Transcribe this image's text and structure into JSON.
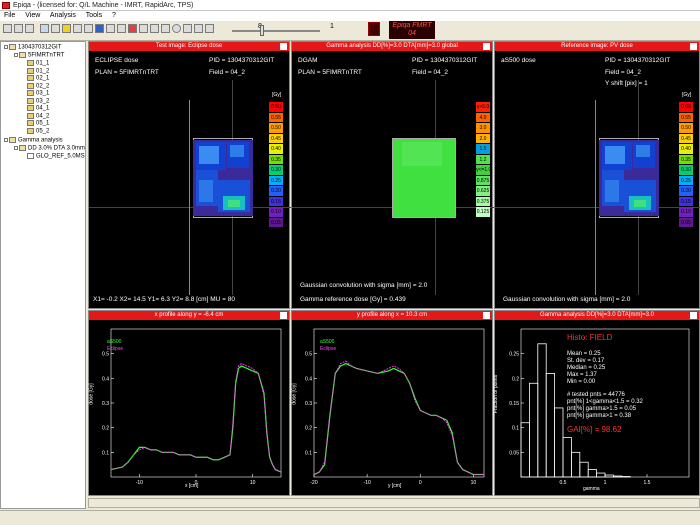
{
  "window": {
    "title": "Epiqa - (licensed for: Q/L Machine - IMRT, RapidArc, TPS)"
  },
  "menu": [
    "File",
    "View",
    "Analysis",
    "Tools",
    "?"
  ],
  "toolbar": {
    "slider_value": "8",
    "slider_right": "1",
    "logo_text": "Epiqa FMRT 04"
  },
  "tree": {
    "root": "1304370312GIT",
    "plan": "5FIMRTnTRT",
    "fields": [
      "01_1",
      "01_2",
      "02_1",
      "02_2",
      "03_1",
      "03_2",
      "04_1",
      "04_2",
      "05_1",
      "05_2"
    ],
    "gamma_group": "Gamma analysis",
    "gamma_item": "DD 3.0% DTA 3.0mm",
    "gamma_sub": "GLO_REF_5.0MS"
  },
  "panels": {
    "p1": {
      "title": "Test image: Eclipse dose",
      "name": "ECLIPSE dose",
      "pid_label": "PID = 1304370312GIT",
      "plan_label": "PLAN = 5FIMRTnTRT",
      "field_label": "Field = 04_2",
      "footer": "X1= -0.2  X2= 14.5  Y1= 6.3  Y2= 8.8  [cm]    MU = 80",
      "unit": "[Gy]",
      "scale": [
        "0.60",
        "0.55",
        "0.50",
        "0.45",
        "0.40",
        "0.35",
        "0.30",
        "0.25",
        "0.20",
        "0.15",
        "0.10",
        "0.05"
      ]
    },
    "p2": {
      "title": "Gamma analysis DD[%]=3.0 DTA[mm]=3.0  global",
      "name": "DGAM",
      "pid_label": "PID = 1304370312GIT",
      "plan_label": "PLAN = 5FIMRTnTRT",
      "field_label": "Field = 04_2",
      "footer1": "Gaussian convolution with sigma [mm] = 2.0",
      "footer2": "Gamma reference dose [Gy] =      0.439",
      "scale": [
        "γ>5.0",
        "4.0",
        "3.0",
        "2.0",
        "1.5",
        "1.2",
        "γ<=1.0",
        "0.875",
        "0.625",
        "0.375",
        "0.125"
      ]
    },
    "p3": {
      "title": "Reference image: PV dose",
      "name": "aS500 dose",
      "pid_label": "PID = 1304370312GIT",
      "field_label": "Field = 04_2",
      "shift_label": "Y shift [pix] =    1",
      "footer": "Gaussian convolution with sigma [mm] = 2.0",
      "unit": "[Gy]",
      "scale": [
        "0.60",
        "0.55",
        "0.50",
        "0.45",
        "0.40",
        "0.35",
        "0.30",
        "0.25",
        "0.20",
        "0.15",
        "0.10",
        "0.05"
      ]
    },
    "p4": {
      "title": "x profile along y =  -6.4 cm",
      "legend1": "aS500",
      "legend2": "Eclipse",
      "xlabel": "x [cm]",
      "ylabel": "dose [Gy]"
    },
    "p5": {
      "title": "y profile along x =  10.3 cm",
      "legend1": "aS500",
      "legend2": "Eclipse",
      "xlabel": "y [cm]",
      "ylabel": "dose [Gy]"
    },
    "p6": {
      "title": "Gamma analysis DD[%]=3.0 DTA[mm]=3.0",
      "histo_title": "Histo: FIELD",
      "stats": [
        "Mean   =  0.25",
        "St. dev  =  0.17",
        "Median  =  0.25",
        "Max      =  1.37",
        "Min      =  0.00"
      ],
      "tested": "# tested pnts  =  44776",
      "pnt1": "pnt[%]  1<gamma<1.5  =  0.32",
      "pnt2": "pnt[%]  gamma>1.5  =  0.05",
      "pnt3": "pnt[%]  gamma>1  =  0.38",
      "gai": "GAI[%]  =   98.62",
      "xlabel": "gamma",
      "ylabel": "Fraction of points"
    }
  },
  "chart_data": [
    {
      "type": "line",
      "title": "x profile along y = -6.4 cm",
      "xlabel": "x [cm]",
      "ylabel": "dose [Gy]",
      "xlim": [
        -15,
        15
      ],
      "ylim": [
        0,
        0.6
      ],
      "xticks": [
        "-10",
        "0",
        "10"
      ],
      "yticks": [
        "0.1",
        "0.2",
        "0.3",
        "0.4",
        "0.5"
      ],
      "x": [
        -15,
        -13,
        -12,
        -11,
        -10,
        -9,
        -8,
        -7,
        -6,
        -5,
        -4,
        -3,
        -2,
        -1,
        0,
        1,
        2,
        3,
        4,
        5,
        6,
        6.5,
        7,
        7.5,
        8,
        9,
        10,
        11,
        12,
        12.5,
        13,
        13.5,
        14,
        15
      ],
      "series": [
        {
          "name": "aS500",
          "values": [
            0.03,
            0.04,
            0.06,
            0.09,
            0.12,
            0.12,
            0.11,
            0.11,
            0.1,
            0.1,
            0.1,
            0.09,
            0.09,
            0.09,
            0.08,
            0.08,
            0.08,
            0.07,
            0.07,
            0.08,
            0.09,
            0.2,
            0.38,
            0.44,
            0.45,
            0.44,
            0.43,
            0.42,
            0.34,
            0.18,
            0.08,
            0.05,
            0.03,
            0.02
          ]
        },
        {
          "name": "Eclipse",
          "values": [
            0.03,
            0.04,
            0.06,
            0.09,
            0.11,
            0.12,
            0.11,
            0.11,
            0.1,
            0.1,
            0.1,
            0.09,
            0.09,
            0.09,
            0.08,
            0.08,
            0.08,
            0.07,
            0.07,
            0.08,
            0.09,
            0.22,
            0.39,
            0.45,
            0.46,
            0.45,
            0.44,
            0.42,
            0.33,
            0.17,
            0.08,
            0.05,
            0.03,
            0.02
          ]
        }
      ]
    },
    {
      "type": "line",
      "title": "y profile along x = 10.3 cm",
      "xlabel": "y [cm]",
      "ylabel": "dose [Gy]",
      "xlim": [
        -20,
        12
      ],
      "ylim": [
        0,
        0.6
      ],
      "xticks": [
        "-20",
        "-10",
        "0",
        "10"
      ],
      "yticks": [
        "0.1",
        "0.2",
        "0.3",
        "0.4",
        "0.5"
      ],
      "x": [
        -20,
        -19,
        -18,
        -17,
        -16,
        -15,
        -14,
        -13,
        -12,
        -10,
        -8,
        -6,
        -5,
        -4,
        -3,
        -2,
        -1,
        0,
        1,
        2,
        3,
        4,
        5,
        6,
        7,
        8,
        9,
        10,
        11,
        12
      ],
      "series": [
        {
          "name": "aS500",
          "values": [
            0.01,
            0.02,
            0.05,
            0.25,
            0.42,
            0.45,
            0.46,
            0.45,
            0.44,
            0.43,
            0.42,
            0.43,
            0.44,
            0.43,
            0.42,
            0.38,
            0.32,
            0.27,
            0.26,
            0.25,
            0.25,
            0.24,
            0.23,
            0.18,
            0.06,
            0.03,
            0.02,
            0.01,
            0.01,
            0.01
          ]
        },
        {
          "name": "Eclipse",
          "values": [
            0.01,
            0.02,
            0.06,
            0.26,
            0.42,
            0.46,
            0.47,
            0.45,
            0.44,
            0.43,
            0.42,
            0.44,
            0.45,
            0.44,
            0.42,
            0.38,
            0.31,
            0.27,
            0.26,
            0.25,
            0.25,
            0.24,
            0.22,
            0.17,
            0.06,
            0.03,
            0.02,
            0.01,
            0.01,
            0.01
          ]
        }
      ]
    },
    {
      "type": "bar",
      "title": "Histo: FIELD",
      "xlabel": "gamma",
      "ylabel": "Fraction of points",
      "xlim": [
        0,
        2
      ],
      "ylim": [
        0,
        0.3
      ],
      "xticks": [
        "0.5",
        "1",
        "1.5"
      ],
      "yticks": [
        "0.05",
        "0.1",
        "0.15",
        "0.2",
        "0.25"
      ],
      "bin_width": 0.1,
      "categories": [
        "0.0",
        "0.1",
        "0.2",
        "0.3",
        "0.4",
        "0.5",
        "0.6",
        "0.7",
        "0.8",
        "0.9",
        "1.0",
        "1.1",
        "1.2",
        "1.3",
        "1.4"
      ],
      "values": [
        0.11,
        0.19,
        0.27,
        0.21,
        0.14,
        0.08,
        0.05,
        0.03,
        0.015,
        0.008,
        0.004,
        0.002,
        0.001,
        0.0,
        0.0
      ]
    }
  ]
}
